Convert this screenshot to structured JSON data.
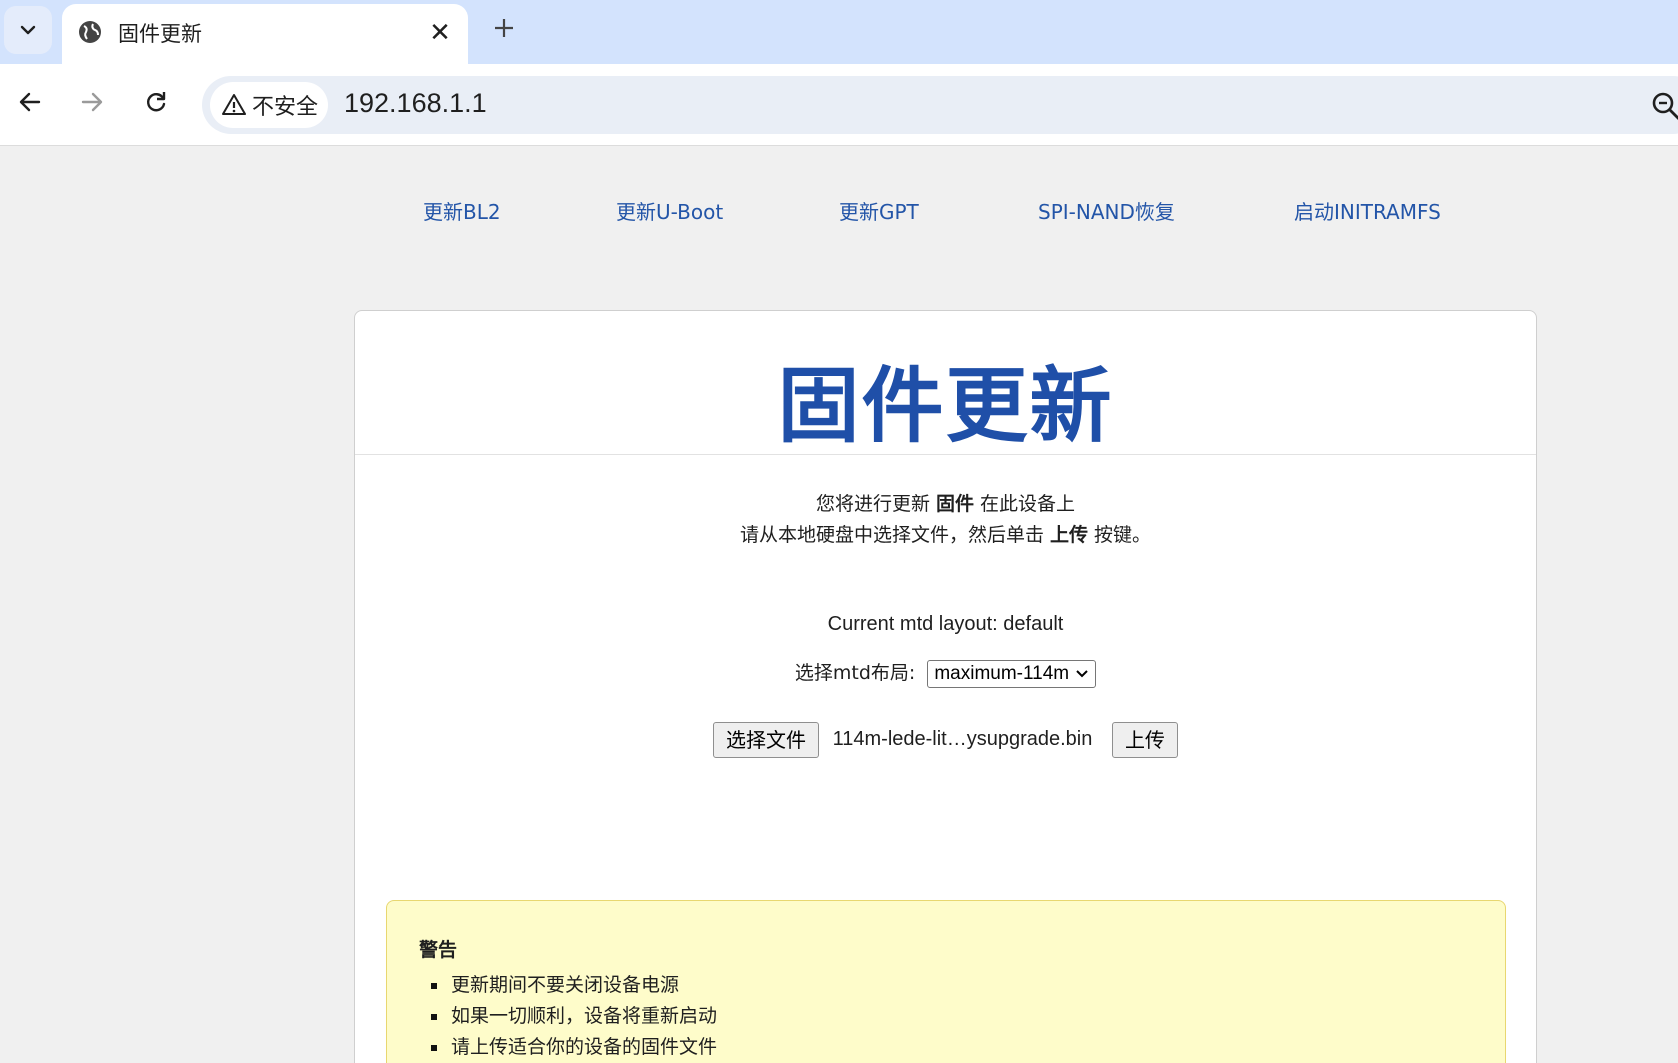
{
  "browser": {
    "tab_title": "固件更新",
    "security_label": "不安全",
    "url": "192.168.1.1"
  },
  "nav": {
    "items": [
      "更新BL2",
      "更新U-Boot",
      "更新GPT",
      "SPI-NAND恢复",
      "启动INITRAMFS"
    ]
  },
  "card": {
    "title": "固件更新",
    "intro_line1_pre": "您将进行更新 ",
    "intro_line1_bold": "固件",
    "intro_line1_post": " 在此设备上",
    "intro_line2_pre": "请从本地硬盘中选择文件，然后单击 ",
    "intro_line2_bold": "上传",
    "intro_line2_post": " 按键。",
    "mtd_current": "Current mtd layout: default",
    "mtd_select_label": "选择mtd布局:",
    "mtd_select_value": "maximum-114m",
    "choose_file_label": "选择文件",
    "file_name": "114m-lede-lit…ysupgrade.bin",
    "upload_label": "上传"
  },
  "warning": {
    "title": "警告",
    "items": [
      "更新期间不要关闭设备电源",
      "如果一切顺利，设备将重新启动",
      "请上传适合你的设备的固件文件"
    ]
  }
}
